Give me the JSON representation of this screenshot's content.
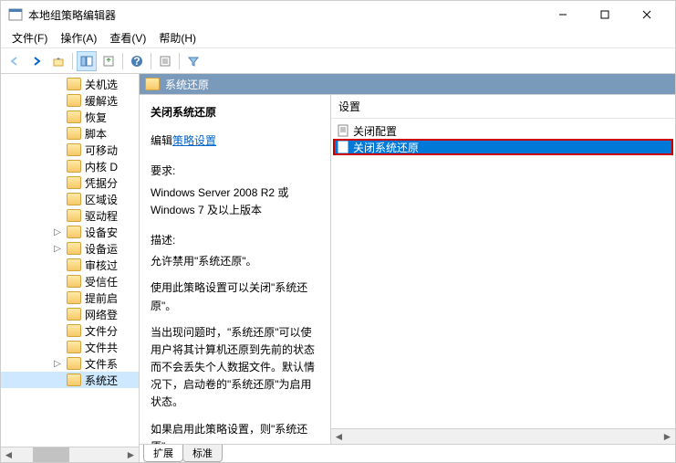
{
  "window": {
    "title": "本地组策略编辑器"
  },
  "menu": {
    "file": "文件(F)",
    "action": "操作(A)",
    "view": "查看(V)",
    "help": "帮助(H)"
  },
  "tree": {
    "items": [
      {
        "label": "关机选",
        "exp": false
      },
      {
        "label": "缓解选",
        "exp": false
      },
      {
        "label": "恢复",
        "exp": false
      },
      {
        "label": "脚本",
        "exp": false
      },
      {
        "label": "可移动",
        "exp": false
      },
      {
        "label": "内核 D",
        "exp": false
      },
      {
        "label": "凭据分",
        "exp": false
      },
      {
        "label": "区域设",
        "exp": false
      },
      {
        "label": "驱动程",
        "exp": false
      },
      {
        "label": "设备安",
        "exp": true
      },
      {
        "label": "设备运",
        "exp": true
      },
      {
        "label": "审核过",
        "exp": false
      },
      {
        "label": "受信任",
        "exp": false
      },
      {
        "label": "提前启",
        "exp": false
      },
      {
        "label": "网络登",
        "exp": false
      },
      {
        "label": "文件分",
        "exp": false
      },
      {
        "label": "文件共",
        "exp": false
      },
      {
        "label": "文件系",
        "exp": true
      },
      {
        "label": "系统还",
        "exp": false,
        "selected": true
      }
    ]
  },
  "header": {
    "title": "系统还原"
  },
  "description": {
    "title": "关闭系统还原",
    "edit_label": "编辑",
    "edit_link": "策略设置",
    "req_label": "要求:",
    "req_text": "Windows Server 2008 R2 或 Windows 7 及以上版本",
    "desc_label": "描述:",
    "desc_text1": "允许禁用\"系统还原\"。",
    "desc_text2": "使用此策略设置可以关闭\"系统还原\"。",
    "desc_text3": "当出现问题时，\"系统还原\"可以使用户将其计算机还原到先前的状态而不会丢失个人数据文件。默认情况下，启动卷的\"系统还原\"为启用状态。",
    "desc_text4": "如果启用此策略设置，则\"系统还原\""
  },
  "settings": {
    "header": "设置",
    "items": [
      {
        "label": "关闭配置",
        "selected": false
      },
      {
        "label": "关闭系统还原",
        "selected": true
      }
    ]
  },
  "tabs": {
    "extended": "扩展",
    "standard": "标准"
  }
}
